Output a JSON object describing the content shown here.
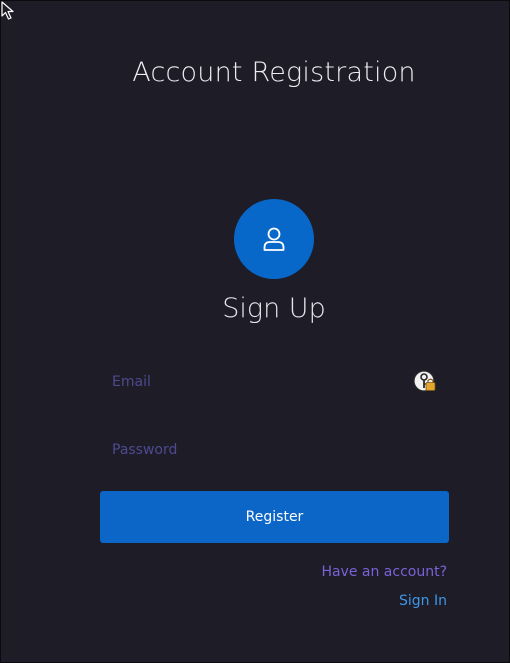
{
  "page": {
    "title": "Account Registration"
  },
  "form": {
    "avatar_icon": "user-icon",
    "heading": "Sign Up",
    "email": {
      "value": "",
      "placeholder": "Email",
      "autofill_icon": "password-manager-key-icon"
    },
    "password": {
      "value": "",
      "placeholder": "Password"
    },
    "register_label": "Register",
    "have_account_label": "Have an account?",
    "sign_in_label": "Sign In"
  },
  "colors": {
    "background": "#1d1c27",
    "primary": "#0b66c8",
    "placeholder": "#4e4a90",
    "link_secondary": "#7a63d6",
    "link_primary": "#3f97e6"
  }
}
